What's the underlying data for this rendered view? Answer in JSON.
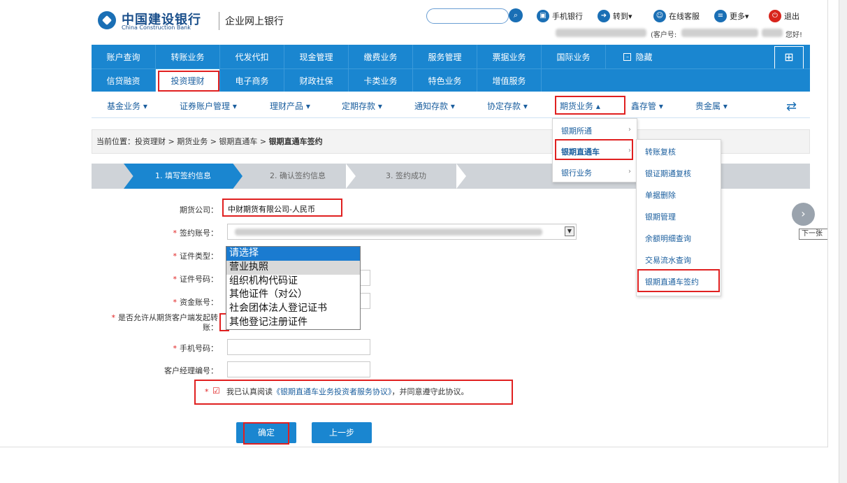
{
  "header": {
    "logo_cn": "中国建设银行",
    "logo_en": "China Construction Bank",
    "portal": "企业网上银行",
    "links": [
      {
        "icon": "mobile-icon",
        "label": "手机银行"
      },
      {
        "icon": "share-icon",
        "label": "转到▾"
      },
      {
        "icon": "service-icon",
        "label": "在线客服"
      },
      {
        "icon": "more-icon",
        "label": "更多▾"
      },
      {
        "icon": "power-icon",
        "label": "退出"
      }
    ],
    "customer_label": "(客户号:",
    "greeting": "您好!"
  },
  "nav_row1": [
    "账户查询",
    "转账业务",
    "代发代扣",
    "现金管理",
    "缴费业务",
    "服务管理",
    "票据业务",
    "国际业务",
    "隐藏"
  ],
  "nav_row2": [
    "信贷融资",
    "投资理财",
    "电子商务",
    "财政社保",
    "卡类业务",
    "特色业务",
    "增值服务"
  ],
  "subnav": [
    "基金业务 ▾",
    "证券账户管理 ▾",
    "理财产品 ▾",
    "定期存款 ▾",
    "通知存款 ▾",
    "协定存款 ▾",
    "期货业务 ▴",
    "鑫存管 ▾",
    "贵金属 ▾"
  ],
  "breadcrumb": {
    "prefix": "当前位置：",
    "path": "投资理财 > 期货业务 > 银期直通车 > ",
    "current": "银期直通车签约"
  },
  "steps": [
    "1. 填写签约信息",
    "2. 确认签约信息",
    "3. 签约成功"
  ],
  "dropdown_level1": [
    "银期所通",
    "银期直通车",
    "银行业务"
  ],
  "dropdown_level2": [
    "转账复核",
    "银证期通复核",
    "单据删除",
    "银期管理",
    "余额明细查询",
    "交易流水查询",
    "银期直通车签约"
  ],
  "form": {
    "futures_company_label": "期货公司：",
    "futures_company_value": "中财期货有限公司-人民币",
    "account_label": "签约账号：",
    "cert_type_label": "证件类型：",
    "cert_no_label": "证件号码：",
    "fund_account_label": "资金账号：",
    "allow_label_1": "是否允许从期货客户端发起转",
    "allow_label_2": "账：",
    "phone_label": "手机号码：",
    "manager_label": "客户经理编号：",
    "cert_type_options": [
      "请选择",
      "营业执照",
      "组织机构代码证",
      "其他证件（对公）",
      "社会团体法人登记证书",
      "其他登记注册证件"
    ],
    "required_mark": "*"
  },
  "agreement": {
    "checkbox_mark": "☑",
    "before": "我已认真阅读",
    "link": "《银期直通车业务投资者服务协议》",
    "after": "，并同意遵守此协议。"
  },
  "buttons": {
    "confirm": "确定",
    "back": "上一步"
  },
  "side": {
    "next_tip": "下一张"
  }
}
